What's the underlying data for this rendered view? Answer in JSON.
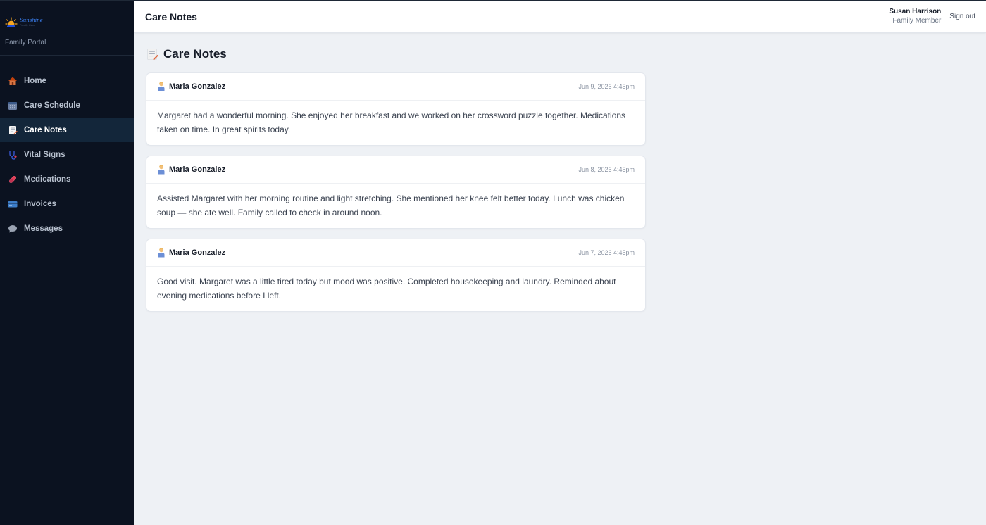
{
  "brand": {
    "logo_name": "Sunshine",
    "logo_tagline": "Family Care",
    "portal_label": "Family Portal"
  },
  "sidebar": {
    "items": [
      {
        "label": "Home",
        "icon": "house-icon",
        "active": false
      },
      {
        "label": "Care Schedule",
        "icon": "calendar-icon",
        "active": false
      },
      {
        "label": "Care Notes",
        "icon": "memo-icon",
        "active": true
      },
      {
        "label": "Vital Signs",
        "icon": "stethoscope-icon",
        "active": false
      },
      {
        "label": "Medications",
        "icon": "pill-icon",
        "active": false
      },
      {
        "label": "Invoices",
        "icon": "credit-card-icon",
        "active": false
      },
      {
        "label": "Messages",
        "icon": "speech-bubble-icon",
        "active": false
      }
    ]
  },
  "topbar": {
    "title": "Care Notes",
    "user_name": "Susan Harrison",
    "user_role": "Family Member",
    "signout_label": "Sign out"
  },
  "main": {
    "heading": "Care Notes",
    "heading_icon": "memo-icon",
    "notes": [
      {
        "author": "Maria Gonzalez",
        "author_icon": "caregiver-icon",
        "time": "Jun 9, 2026 4:45pm",
        "body": "Margaret had a wonderful morning. She enjoyed her breakfast and we worked on her crossword puzzle together. Medications taken on time. In great spirits today."
      },
      {
        "author": "Maria Gonzalez",
        "author_icon": "caregiver-icon",
        "time": "Jun 8, 2026 4:45pm",
        "body": "Assisted Margaret with her morning routine and light stretching. She mentioned her knee felt better today. Lunch was chicken soup — she ate well. Family called to check in around noon."
      },
      {
        "author": "Maria Gonzalez",
        "author_icon": "caregiver-icon",
        "time": "Jun 7, 2026 4:45pm",
        "body": "Good visit. Margaret was a little tired today but mood was positive. Completed housekeeping and laundry. Reminded about evening medications before I left."
      }
    ]
  },
  "colors": {
    "sidebar_bg": "#0b1220",
    "sidebar_active_bg": "#13263a",
    "page_bg": "#eef1f5",
    "logo_accent": "#3b82f6"
  }
}
